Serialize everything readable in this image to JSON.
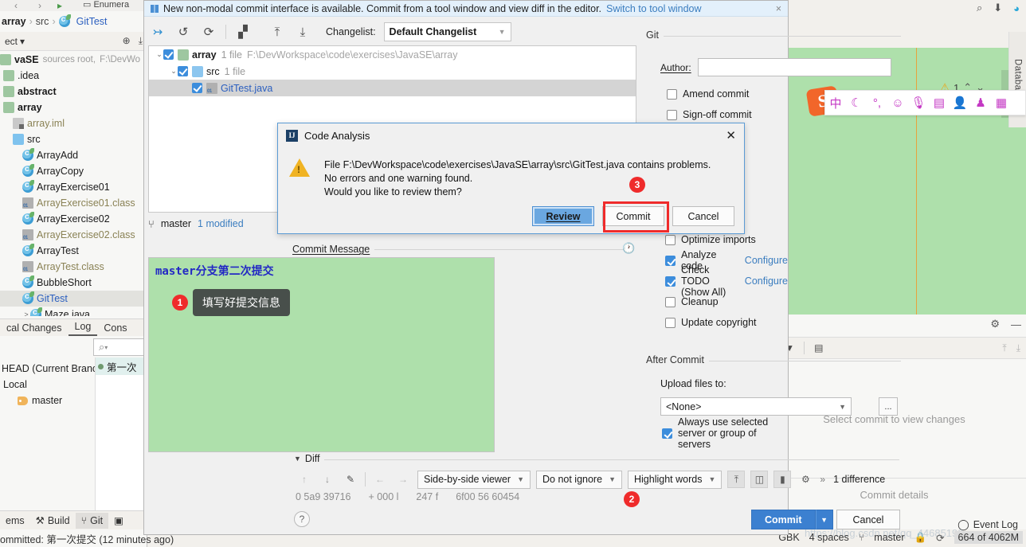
{
  "ide": {
    "breadcrumb": {
      "project": "array",
      "sep": "›",
      "folder": "src",
      "file": "GitTest"
    },
    "project_toolbar": {
      "label": "ect",
      "caret": "▾"
    },
    "tree_header": {
      "name": "vaSE",
      "meta": "sources root,",
      "path": "F:\\DevWo"
    },
    "tree": [
      {
        "label": ".idea",
        "type": "folder-mod",
        "indent": 0,
        "bold": false,
        "muted": false
      },
      {
        "label": "abstract",
        "type": "folder-mod",
        "indent": 0,
        "bold": true,
        "muted": false
      },
      {
        "label": "array",
        "type": "folder-mod",
        "indent": 0,
        "bold": true,
        "muted": false
      },
      {
        "label": "array.iml",
        "type": "iml",
        "indent": 1,
        "bold": false,
        "muted": true
      },
      {
        "label": "src",
        "type": "folder-src",
        "indent": 1,
        "bold": false,
        "muted": false
      },
      {
        "label": "ArrayAdd",
        "type": "class",
        "indent": 2,
        "bold": false,
        "muted": false
      },
      {
        "label": "ArrayCopy",
        "type": "class",
        "indent": 2,
        "bold": false,
        "muted": false
      },
      {
        "label": "ArrayExercise01",
        "type": "class",
        "indent": 2,
        "bold": false,
        "muted": false
      },
      {
        "label": "ArrayExercise01.class",
        "type": "compiled",
        "indent": 2,
        "bold": false,
        "muted": true
      },
      {
        "label": "ArrayExercise02",
        "type": "class",
        "indent": 2,
        "bold": false,
        "muted": false
      },
      {
        "label": "ArrayExercise02.class",
        "type": "compiled",
        "indent": 2,
        "bold": false,
        "muted": true
      },
      {
        "label": "ArrayTest",
        "type": "class",
        "indent": 2,
        "bold": false,
        "muted": false
      },
      {
        "label": "ArrayTest.class",
        "type": "compiled",
        "indent": 2,
        "bold": false,
        "muted": true
      },
      {
        "label": "BubbleShort",
        "type": "class",
        "indent": 2,
        "bold": false,
        "muted": false
      },
      {
        "label": "GitTest",
        "type": "class",
        "indent": 2,
        "bold": false,
        "muted": false,
        "selected": true,
        "blue": true
      },
      {
        "label": "Maze.java",
        "type": "class",
        "indent": 2,
        "bold": false,
        "muted": false
      }
    ],
    "vcs_tabs": [
      {
        "label": "cal Changes",
        "active": false
      },
      {
        "label": "Log",
        "active": true
      },
      {
        "label": "Cons",
        "active": false
      }
    ],
    "branch_search_placeholder": "Q",
    "branch_tree": [
      {
        "label": "HEAD (Current Branc",
        "indent": 0,
        "icon": "none"
      },
      {
        "label": "Local",
        "indent": 0,
        "icon": "none"
      },
      {
        "label": "master",
        "indent": 1,
        "icon": "tag"
      }
    ],
    "commit_rows": [
      {
        "label": "第一次"
      }
    ],
    "bottom_tabs": [
      {
        "label": "ems",
        "icon": "none",
        "active": false
      },
      {
        "label": "Build",
        "icon": "hammer-icon",
        "active": false
      },
      {
        "label": "Git",
        "icon": "git-branch-icon",
        "active": true
      },
      {
        "label": "",
        "icon": "terminal-icon",
        "active": false
      }
    ],
    "status_left": "ommitted: 第一次提交 (12 minutes ago)",
    "editor_warning_count": "1",
    "database_label": "Database",
    "right_panel": {
      "empty_message": "Select commit to view changes",
      "details_message": "Commit details"
    },
    "event_log": "Event Log",
    "status_right": {
      "encoding": "GBK",
      "indent": "4 spaces",
      "branch": "master",
      "memory": "664 of 4062M"
    },
    "ime": {
      "logo": "S",
      "items": [
        "中",
        "☾",
        "°,",
        "☺",
        "🎤",
        "⌨",
        "👥",
        "👕",
        "▦"
      ]
    },
    "watermark": "https://blog.csdn.net/qq_44685190"
  },
  "commit_dialog": {
    "notification": {
      "text": "New non-modal commit interface is available. Commit from a tool window and view diff in the editor.",
      "link": "Switch to tool window",
      "close": "×"
    },
    "toolbar": {
      "icons": [
        "collapse-arrows-icon",
        "undo-icon",
        "refresh-icon",
        "group-by-icon",
        "expand-all-icon",
        "collapse-all-icon"
      ],
      "changelist_label": "Changelist:",
      "changelist_value": "Default Changelist",
      "changelist_arrow": "▼"
    },
    "file_tree": [
      {
        "label": "array",
        "count": "1 file",
        "path": "F:\\DevWorkspace\\code\\exercises\\JavaSE\\array",
        "indent": 0,
        "type": "folder-mod",
        "checked": true,
        "chevron": "⌄"
      },
      {
        "label": "src",
        "count": "1 file",
        "path": "",
        "indent": 1,
        "type": "folder",
        "checked": true,
        "chevron": "⌄"
      },
      {
        "label": "GitTest.java",
        "count": "",
        "path": "",
        "indent": 2,
        "type": "java-file",
        "checked": true,
        "chevron": "",
        "selected": true
      }
    ],
    "branch_bar": {
      "branch": "master",
      "modified": "1 modified"
    },
    "commit_message": {
      "title": "Commit Message",
      "value": "master分支第二次提交",
      "clock_icon": "history-icon"
    },
    "git_section": {
      "title": "Git",
      "author_label": "Author:",
      "author_value": "",
      "options": [
        {
          "label": "Amend commit",
          "checked": false
        },
        {
          "label": "Sign-off commit",
          "checked": false
        }
      ]
    },
    "before_options": [
      {
        "label": "Optimize imports",
        "checked": false,
        "link": ""
      },
      {
        "label": "Analyze code",
        "checked": true,
        "link": "Configure"
      },
      {
        "label": "Check TODO (Show All)",
        "checked": true,
        "link": "Configure"
      },
      {
        "label": "Cleanup",
        "checked": false,
        "link": ""
      },
      {
        "label": "Update copyright",
        "checked": false,
        "link": ""
      }
    ],
    "after_commit": {
      "title": "After Commit",
      "upload_label": "Upload files to:",
      "upload_value": "<None>",
      "upload_arrow": "▼",
      "browse_label": "...",
      "always_label": "Always use selected server or group of servers",
      "always_checked": true
    },
    "diff": {
      "title": "Diff",
      "collapse_arrow": "▼",
      "nav_icons": [
        "arrow-up-icon",
        "arrow-down-icon",
        "edit-icon",
        "arrow-left-icon",
        "arrow-right-icon"
      ],
      "viewer_mode": "Side-by-side viewer",
      "ignore_mode": "Do not ignore",
      "highlight_mode": "Highlight words",
      "tool_icons": [
        "collapse-unchanged-icon",
        "compare-columns-icon",
        "lock-icon",
        "settings-icon"
      ],
      "overflow": "»",
      "difference_count": "1 difference",
      "partial_row": [
        "0 5a9 39716",
        "+ 000 l",
        "247 f",
        "6f00 56 60454"
      ]
    },
    "footer": {
      "help": "?",
      "commit_label": "Commit",
      "commit_arrow": "▼",
      "cancel_label": "Cancel"
    }
  },
  "code_analysis_dialog": {
    "title": "Code Analysis",
    "close": "✕",
    "warning_icon": "warning-triangle-icon",
    "message_line1": "File F:\\DevWorkspace\\code\\exercises\\JavaSE\\array\\src\\GitTest.java contains problems.",
    "message_line2": "No errors and one warning found.",
    "message_line3": "Would you like to review them?",
    "buttons": {
      "review": "Review",
      "commit": "Commit",
      "cancel": "Cancel"
    }
  },
  "annotations": [
    {
      "number": "1",
      "text": "填写好提交信息"
    },
    {
      "number": "2",
      "text": ""
    },
    {
      "number": "3",
      "text": ""
    }
  ],
  "colors": {
    "accent_blue": "#3c80d0",
    "editor_green": "#aee0ab",
    "callout_red": "#ef2b2b",
    "warn_yellow": "#f0b323"
  }
}
